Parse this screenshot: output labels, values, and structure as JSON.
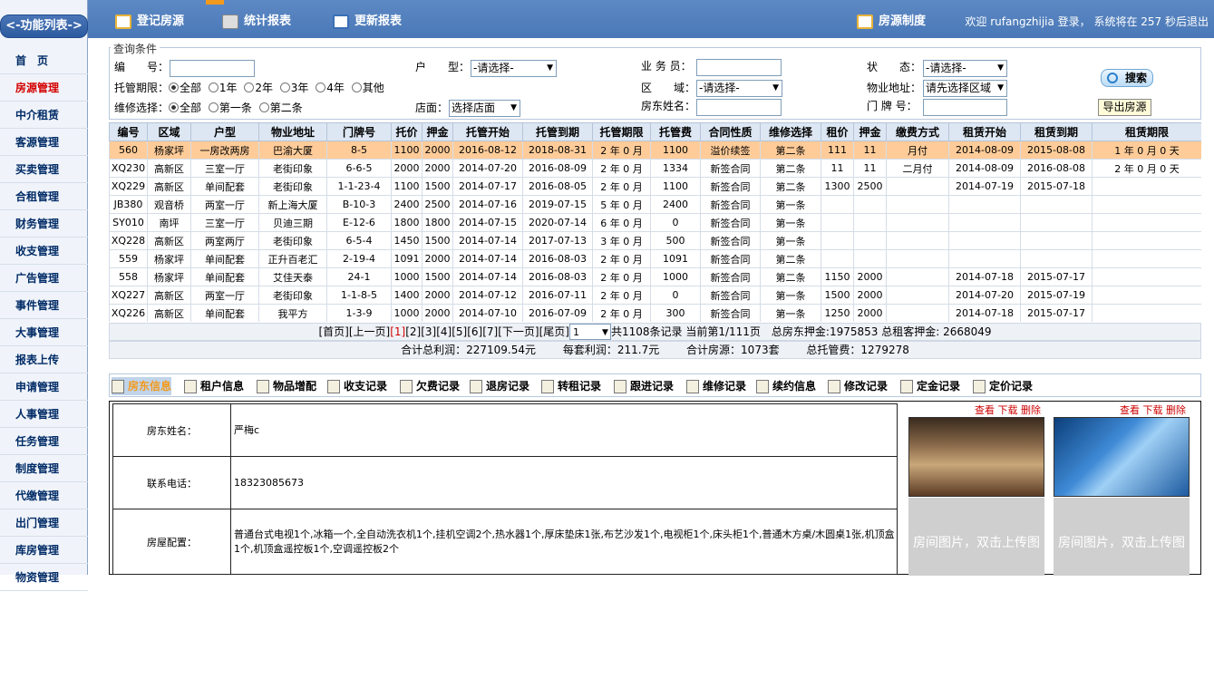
{
  "sidebar": {
    "title": "<-功能列表->",
    "items": [
      "首　页",
      "房源管理",
      "中介租赁",
      "客源管理",
      "买卖管理",
      "合租管理",
      "财务管理",
      "收支管理",
      "广告管理",
      "事件管理",
      "大事管理",
      "报表上传",
      "申请管理",
      "人事管理",
      "任务管理",
      "制度管理",
      "代缴管理",
      "出门管理",
      "库房管理",
      "物资管理"
    ],
    "active": "房源管理"
  },
  "topbar": {
    "btn_register": "登记房源",
    "btn_stats": "统计报表",
    "btn_update": "更新报表",
    "btn_policy": "房源制度",
    "welcome": "欢迎 rufangzhijia 登录， 系统将在 257 秒后退出"
  },
  "query": {
    "legend": "查询条件",
    "f_code": "编　　号：",
    "f_type": "户　　型：",
    "f_type_val": "-请选择-",
    "f_agent": "业 务 员：",
    "f_status": "状　　态：",
    "f_status_val": "-请选择-",
    "f_term": "托管期限：",
    "term_opts": [
      "全部",
      "1年",
      "2年",
      "3年",
      "4年",
      "其他"
    ],
    "f_area": "区　　域：",
    "f_area_val": "-请选择-",
    "f_addr": "物业地址：",
    "f_addr_val": "请先选择区域",
    "f_repair": "维修选择：",
    "repair_opts": [
      "全部",
      "第一条",
      "第二条"
    ],
    "f_store": "店面：",
    "f_store_val": "选择店面",
    "f_owner": "房东姓名：",
    "f_door": "门 牌 号：",
    "search": "搜索",
    "export": "导出房源"
  },
  "grid": {
    "columns": [
      "编号",
      "区域",
      "户型",
      "物业地址",
      "门牌号",
      "托价",
      "押金",
      "托管开始",
      "托管到期",
      "托管期限",
      "托管费",
      "合同性质",
      "维修选择",
      "租价",
      "押金",
      "缴费方式",
      "租赁开始",
      "租赁到期",
      "租赁期限"
    ],
    "rows": [
      [
        "560",
        "杨家坪",
        "一房改两房",
        "巴渝大厦",
        "8-5",
        "1100",
        "2000",
        "2016-08-12",
        "2018-08-31",
        "2 年 0 月",
        "1100",
        "溢价续签",
        "第二条",
        "111",
        "11",
        "月付",
        "2014-08-09",
        "2015-08-08",
        "1 年 0 月 0 天"
      ],
      [
        "XQ230",
        "高新区",
        "三室一厅",
        "老街印象",
        "6-6-5",
        "2000",
        "2000",
        "2014-07-20",
        "2016-08-09",
        "2 年 0 月",
        "1334",
        "新签合同",
        "第二条",
        "11",
        "11",
        "二月付",
        "2014-08-09",
        "2016-08-08",
        "2 年 0 月 0 天"
      ],
      [
        "XQ229",
        "高新区",
        "单间配套",
        "老街印象",
        "1-1-23-4",
        "1100",
        "1500",
        "2014-07-17",
        "2016-08-05",
        "2 年 0 月",
        "1100",
        "新签合同",
        "第二条",
        "1300",
        "2500",
        "",
        "2014-07-19",
        "2015-07-18",
        ""
      ],
      [
        "JB380",
        "观音桥",
        "两室一厅",
        "新上海大厦",
        "B-10-3",
        "2400",
        "2500",
        "2014-07-16",
        "2019-07-15",
        "5 年 0 月",
        "2400",
        "新签合同",
        "第一条",
        "",
        "",
        "",
        "",
        "",
        ""
      ],
      [
        "SY010",
        "南坪",
        "三室一厅",
        "贝迪三期",
        "E-12-6",
        "1800",
        "1800",
        "2014-07-15",
        "2020-07-14",
        "6 年 0 月",
        "0",
        "新签合同",
        "第一条",
        "",
        "",
        "",
        "",
        "",
        ""
      ],
      [
        "XQ228",
        "高新区",
        "两室两厅",
        "老街印象",
        "6-5-4",
        "1450",
        "1500",
        "2014-07-14",
        "2017-07-13",
        "3 年 0 月",
        "500",
        "新签合同",
        "第一条",
        "",
        "",
        "",
        "",
        "",
        ""
      ],
      [
        "559",
        "杨家坪",
        "单间配套",
        "正升百老汇",
        "2-19-4",
        "1091",
        "2000",
        "2014-07-14",
        "2016-08-03",
        "2 年 0 月",
        "1091",
        "新签合同",
        "第二条",
        "",
        "",
        "",
        "",
        "",
        ""
      ],
      [
        "558",
        "杨家坪",
        "单间配套",
        "艾佳天泰",
        "24-1",
        "1000",
        "1500",
        "2014-07-14",
        "2016-08-03",
        "2 年 0 月",
        "1000",
        "新签合同",
        "第二条",
        "1150",
        "2000",
        "",
        "2014-07-18",
        "2015-07-17",
        ""
      ],
      [
        "XQ227",
        "高新区",
        "两室一厅",
        "老街印象",
        "1-1-8-5",
        "1400",
        "2000",
        "2014-07-12",
        "2016-07-11",
        "2 年 0 月",
        "0",
        "新签合同",
        "第一条",
        "1500",
        "2000",
        "",
        "2014-07-20",
        "2015-07-19",
        ""
      ],
      [
        "XQ226",
        "高新区",
        "单间配套",
        "我平方",
        "1-3-9",
        "1000",
        "2000",
        "2014-07-10",
        "2016-07-09",
        "2 年 0 月",
        "300",
        "新签合同",
        "第一条",
        "1250",
        "2000",
        "",
        "2014-07-18",
        "2015-07-17",
        ""
      ]
    ]
  },
  "pager": {
    "links": [
      "[首页]",
      "[上一页]",
      "[1]",
      "[2]",
      "[3]",
      "[4]",
      "[5]",
      "[6]",
      "[7]",
      "[下一页]",
      "[尾页]"
    ],
    "current": "[1]",
    "page_sel": "1",
    "summary": "共1108条记录 当前第1/111页　总房东押金:1975853 总租客押金: 2668049"
  },
  "totals": {
    "profit": "合计总利润：227109.54元",
    "avg": "每套利润：211.7元",
    "rooms": "合计房源：1073套",
    "fee": "总托管费：1279278"
  },
  "tabs": {
    "items": [
      "房东信息",
      "租户信息",
      "物品增配",
      "收支记录",
      "欠费记录",
      "退房记录",
      "转租记录",
      "跟进记录",
      "维修记录",
      "续约信息",
      "修改记录",
      "定金记录",
      "定价记录"
    ],
    "active": "房东信息"
  },
  "detail": {
    "owner_k": "房东姓名：",
    "owner_v": "严梅c",
    "phone_k": "联系电话：",
    "phone_v": "18323085673",
    "config_k": "房屋配置：",
    "config_v": "普通台式电视1个,冰箱一个,全自动洗衣机1个,挂机空调2个,热水器1个,厚床垫床1张,布艺沙发1个,电视柜1个,床头柜1个,普通木方桌/木圆桌1张,机顶盒1个,机顶盒遥控板1个,空调遥控板2个"
  },
  "photos": {
    "view": "查看",
    "download": "下载",
    "delete": "删除",
    "empty": "房间图片，双击上传图片"
  }
}
